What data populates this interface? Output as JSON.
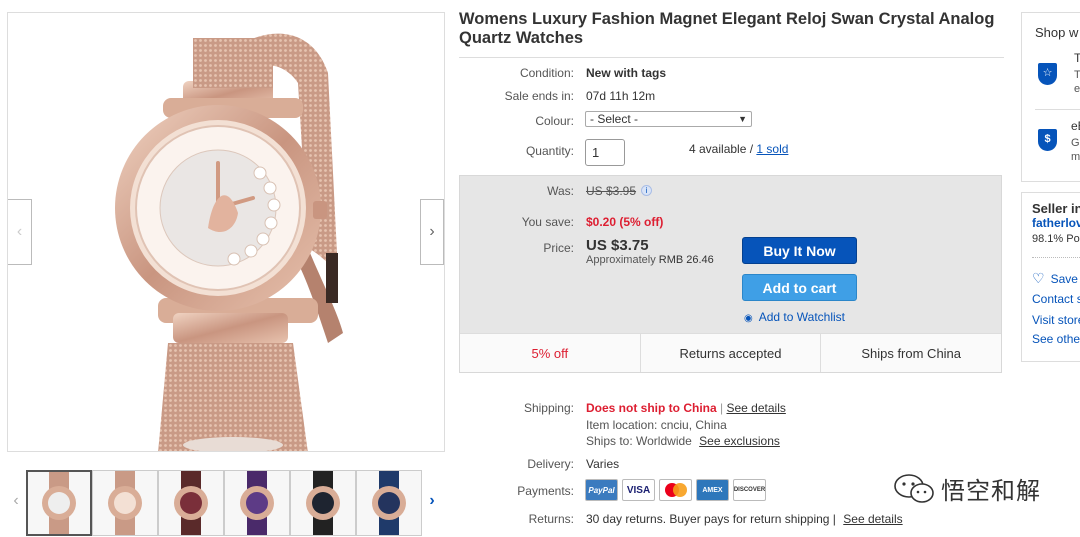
{
  "gallery": {
    "prev_arrow": "‹",
    "next_arrow": "›",
    "thumb_prev": "‹",
    "thumb_next": "›",
    "thumb_count": 6
  },
  "title": "Womens Luxury Fashion Magnet Elegant Reloj Swan Crystal Analog Quartz Watches",
  "details": {
    "condition_label": "Condition:",
    "condition_value": "New with tags",
    "sale_label": "Sale ends in:",
    "sale_value": "07d 11h 12m",
    "colour_label": "Colour:",
    "colour_value": "- Select -",
    "quantity_label": "Quantity:",
    "quantity_value": "1",
    "available": "4 available /",
    "sold": "1 sold"
  },
  "price": {
    "was_label": "Was:",
    "was_value": "US $3.95",
    "save_label": "You save:",
    "save_value": "$0.20 (5% off)",
    "price_label": "Price:",
    "price_value": "US $3.75",
    "approx_prefix": "Approximately",
    "approx_value": "RMB 26.46",
    "buy_now": "Buy It Now",
    "add_to_cart": "Add to cart",
    "watchlist": "Add to Watchlist"
  },
  "features": [
    "5% off",
    "Returns accepted",
    "Ships from China"
  ],
  "shipping": {
    "shipping_label": "Shipping:",
    "no_ship": "Does not ship to China",
    "see_details": "See details",
    "location": "Item location:  cnciu, China",
    "ships_to_prefix": "Ships to:  Worldwide",
    "see_exclusions": "See exclusions",
    "delivery_label": "Delivery:",
    "delivery_value": "Varies",
    "payments_label": "Payments:",
    "returns_label": "Returns:",
    "returns_value": "30 day returns. Buyer pays for return shipping |",
    "returns_link": "See details"
  },
  "payments": [
    "PayPal",
    "VISA",
    "MC",
    "AMEX",
    "DISCOVER"
  ],
  "sidebar": {
    "shop_title": "Shop w",
    "item1_title": "T",
    "item1_sub1": "T",
    "item1_sub2": "e",
    "item2_title": "eB",
    "item2_sub1": "Ge",
    "item2_sub2": "m",
    "seller_title": "Seller in",
    "seller_name": "fatherlov",
    "seller_rating": "98.1% Po",
    "save_seller": "Save",
    "contact": "Contact s",
    "visit_store": "Visit store",
    "see_other": "See other"
  },
  "watermark": "悟空和解",
  "colors": {
    "accent_blue": "#0654ba",
    "cart_blue": "#3f9fe6",
    "sale_red": "#dd1e31",
    "rose_gold": "#d4a48c"
  }
}
